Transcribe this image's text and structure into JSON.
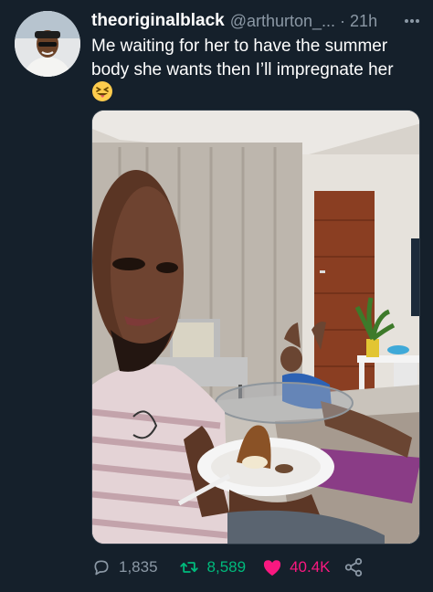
{
  "tweet": {
    "display_name": "theoriginalblack",
    "handle": "@arthurton_...",
    "separator": "·",
    "timestamp": "21h",
    "text": "Me waiting for her to have the summer body she wants then I’ll impregnate her",
    "emoji": "squinting-face-with-tongue"
  },
  "actions": {
    "replies": "1,835",
    "retweets": "8,589",
    "likes": "40.4K"
  },
  "icons": {
    "more": "more-icon",
    "reply": "reply-icon",
    "retweet": "retweet-icon",
    "like": "heart-icon",
    "share": "share-icon"
  },
  "colors": {
    "background": "#15202b",
    "secondary_text": "#8b98a5",
    "retweet_green": "#00ba7c",
    "like_pink": "#f91880"
  }
}
